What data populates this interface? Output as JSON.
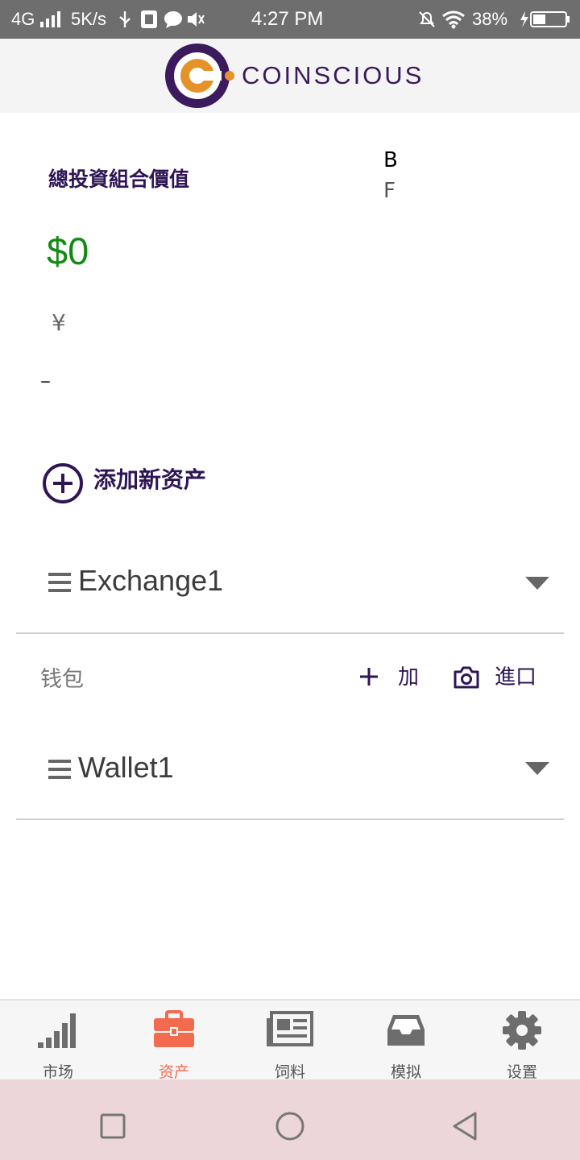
{
  "status_bar": {
    "network": "4G",
    "speed": "5K/s",
    "time": "4:27 PM",
    "battery": "38%"
  },
  "header": {
    "brand": "COINSCIOUS"
  },
  "portfolio": {
    "title": "總投資組合價值",
    "value": "$0",
    "currency_symbol": "¥",
    "dash": "–",
    "side_letter_1": "B",
    "side_letter_2": "F"
  },
  "add_asset": {
    "label": "添加新资产"
  },
  "exchange": {
    "name": "Exchange1"
  },
  "wallets": {
    "section_label": "钱包",
    "add_label": "加",
    "import_label": "進口",
    "items": [
      {
        "name": "Wallet1"
      }
    ]
  },
  "bottom_nav": {
    "items": [
      {
        "label": "市场",
        "icon": "signal-bars-icon",
        "active": false
      },
      {
        "label": "资产",
        "icon": "briefcase-icon",
        "active": true
      },
      {
        "label": "饲料",
        "icon": "newspaper-icon",
        "active": false
      },
      {
        "label": "模拟",
        "icon": "inbox-tray-icon",
        "active": false
      },
      {
        "label": "设置",
        "icon": "gear-icon",
        "active": false
      }
    ],
    "active_color": "#f26b4f",
    "inactive_color": "#6d6d6d"
  },
  "colors": {
    "accent_purple": "#2e1655",
    "value_green": "#138a13"
  }
}
